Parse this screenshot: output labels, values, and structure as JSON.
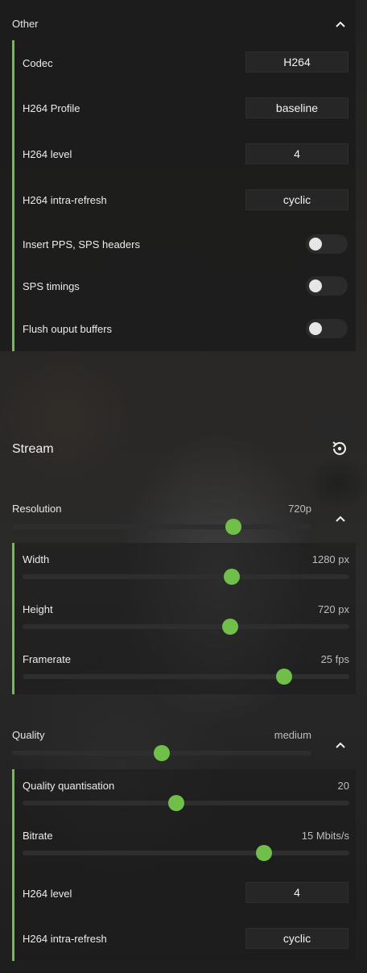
{
  "other": {
    "title": "Other",
    "codec": {
      "label": "Codec",
      "value": "H264"
    },
    "profile": {
      "label": "H264 Profile",
      "value": "baseline"
    },
    "level": {
      "label": "H264 level",
      "value": "4"
    },
    "intra": {
      "label": "H264 intra-refresh",
      "value": "cyclic"
    },
    "toggles": [
      {
        "label": "Insert PPS, SPS headers",
        "on": false
      },
      {
        "label": "SPS timings",
        "on": false
      },
      {
        "label": "Flush ouput buffers",
        "on": false
      }
    ]
  },
  "stream": {
    "title": "Stream",
    "reset_icon": "reset-icon",
    "resolution": {
      "label": "Resolution",
      "value": "720p",
      "fraction": 0.74
    },
    "width": {
      "label": "Width",
      "value": "1280 px",
      "fraction": 0.64
    },
    "height": {
      "label": "Height",
      "value": "720 px",
      "fraction": 0.635
    },
    "framerate": {
      "label": "Framerate",
      "value": "25 fps",
      "fraction": 0.8
    },
    "quality": {
      "label": "Quality",
      "value": "medium",
      "fraction": 0.5
    },
    "quant": {
      "label": "Quality quantisation",
      "value": "20",
      "fraction": 0.47
    },
    "bitrate": {
      "label": "Bitrate",
      "value": "15 Mbits/s",
      "fraction": 0.74
    },
    "level": {
      "label": "H264 level",
      "value": "4"
    },
    "intra": {
      "label": "H264 intra-refresh",
      "value": "cyclic"
    }
  },
  "colors": {
    "accent": "#6fbf4a",
    "panel": "#1c1c1c"
  }
}
